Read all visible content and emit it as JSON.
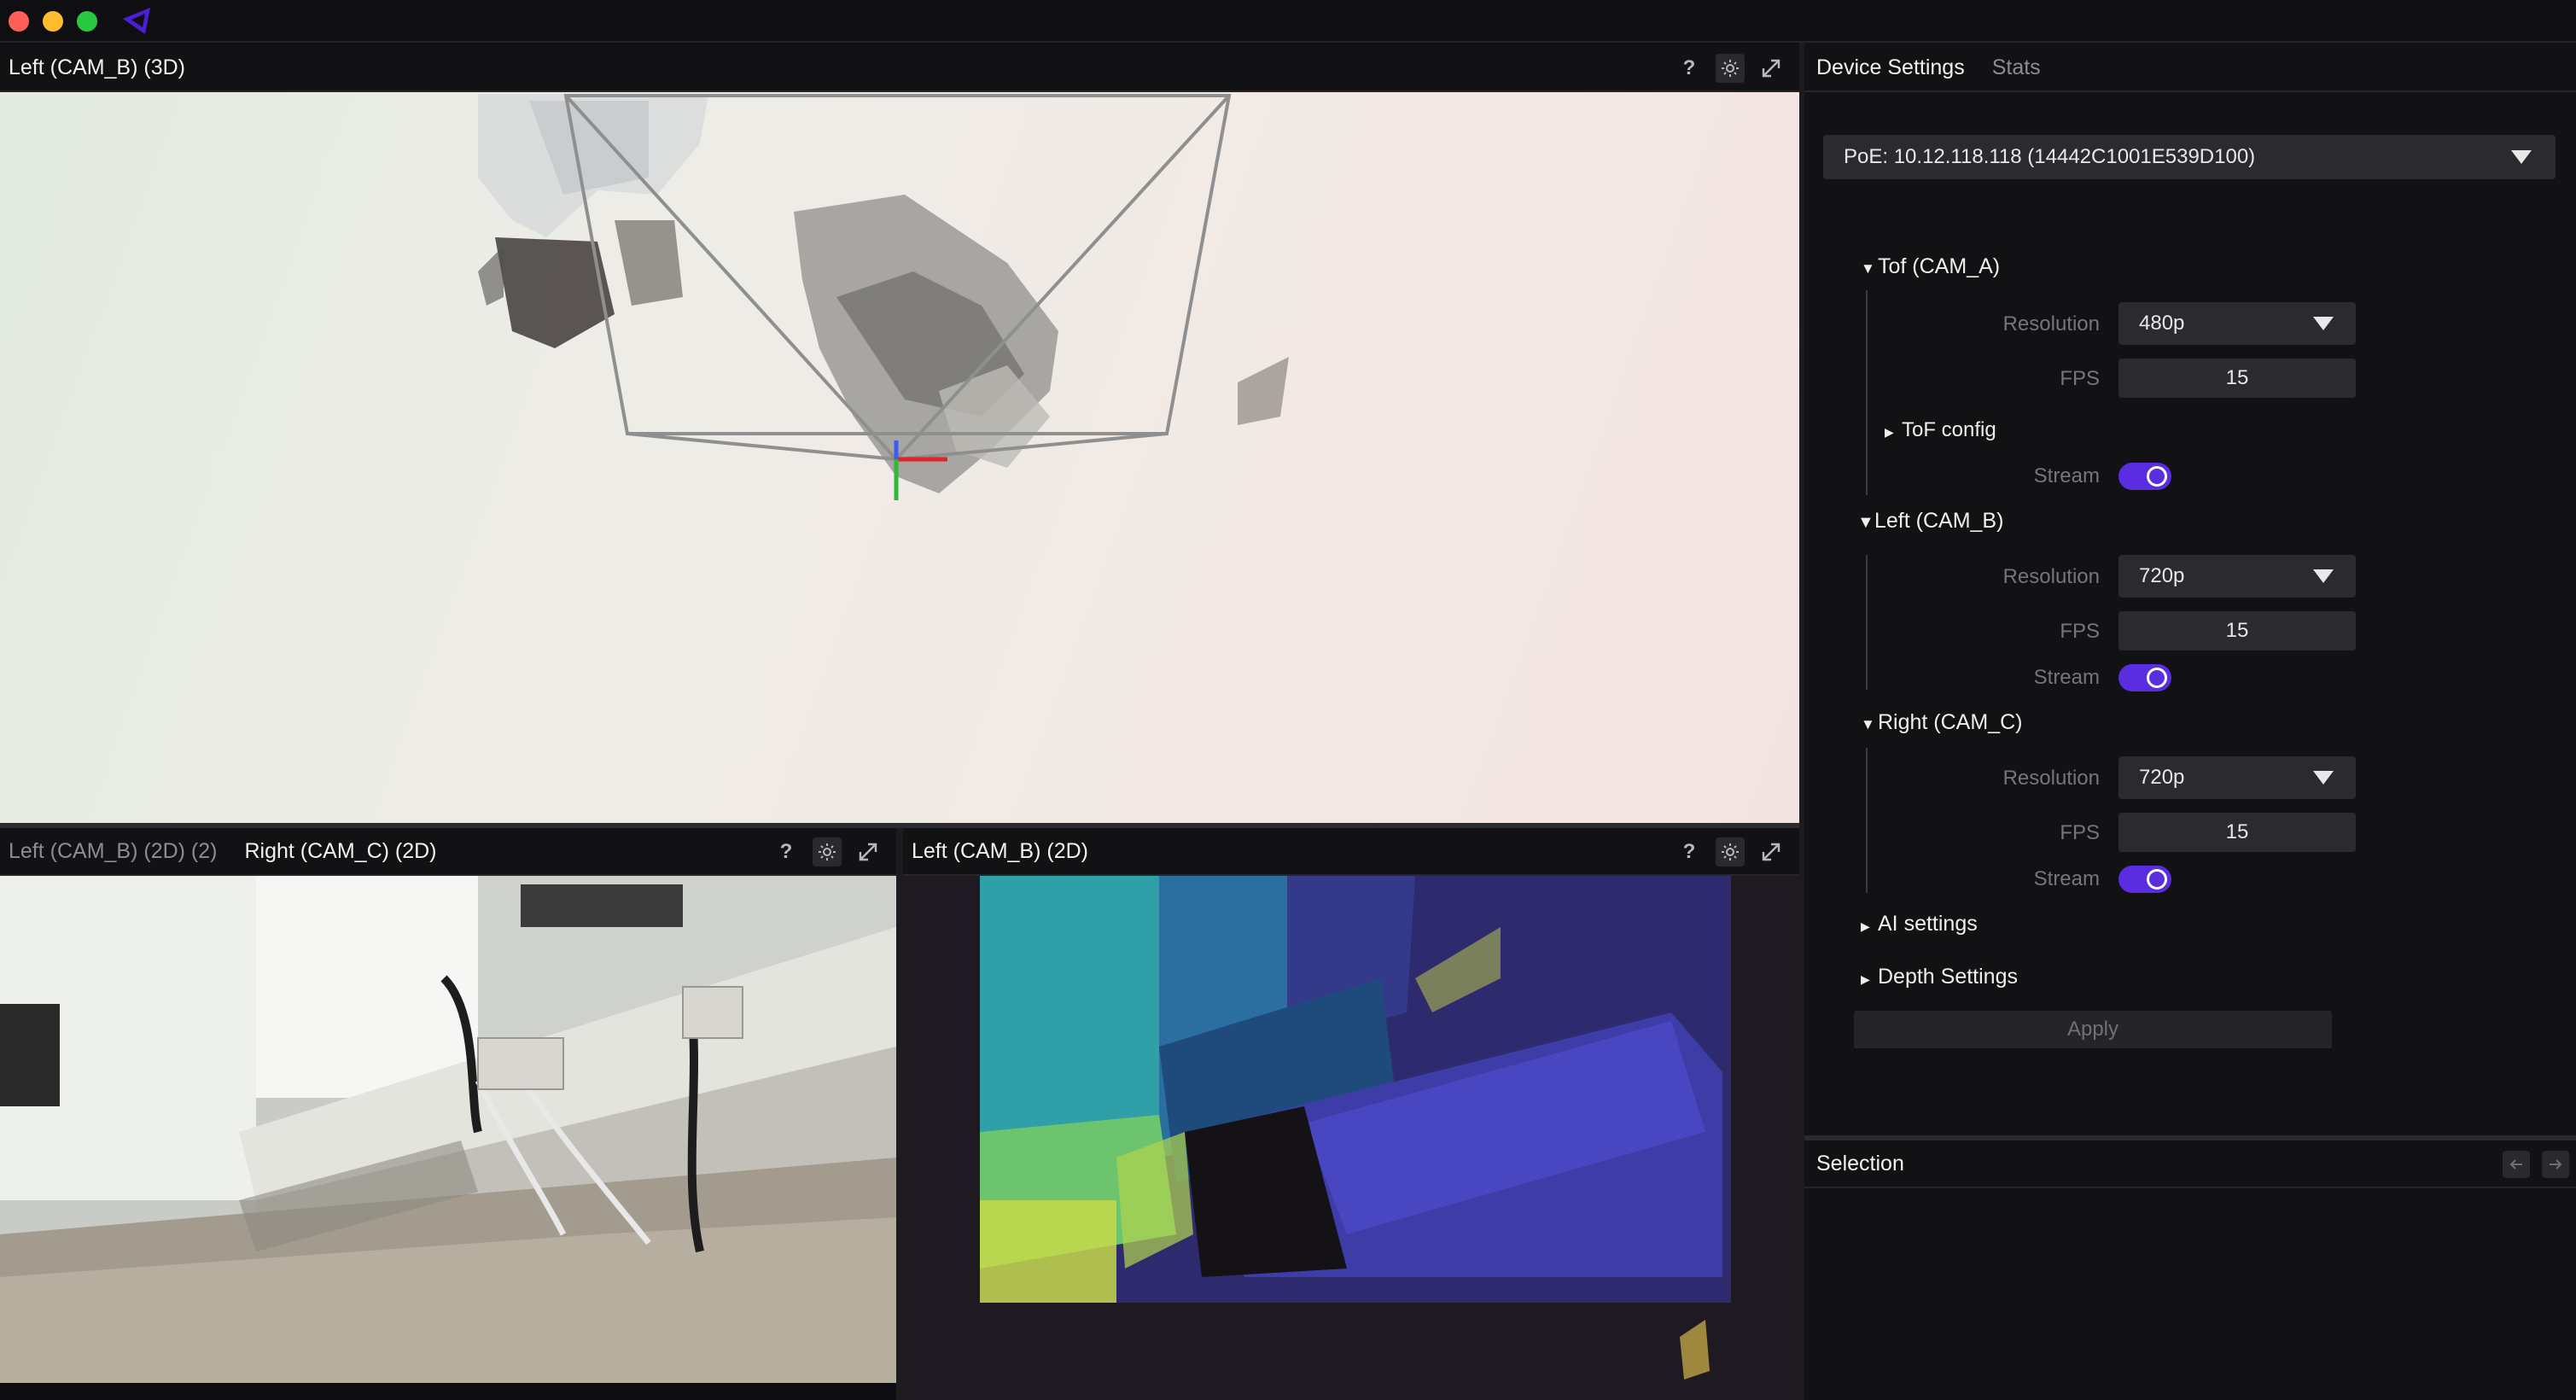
{
  "app": {
    "logo_icon": "rerun-triangle-logo",
    "colors": {
      "accent": "#5a2de0",
      "close": "#fe5f57",
      "minimize": "#febc2e",
      "maximize": "#28c840"
    }
  },
  "view_3d": {
    "title": "Left (CAM_B) (3D)",
    "help": "?",
    "icons": [
      "gear-icon",
      "expand-icon"
    ]
  },
  "view_bottom_left": {
    "tabs": [
      {
        "label": "Left (CAM_B) (2D) (2)",
        "active": false
      },
      {
        "label": "Right (CAM_C) (2D)",
        "active": true
      }
    ],
    "help": "?"
  },
  "view_bottom_right": {
    "title": "Left (CAM_B) (2D)",
    "help": "?"
  },
  "right_panel": {
    "tabs": [
      {
        "label": "Device Settings",
        "active": true
      },
      {
        "label": "Stats",
        "active": false
      }
    ],
    "device": "PoE: 10.12.118.118 (14442C1001E539D100)",
    "sections": {
      "tof": {
        "title": "Tof (CAM_A)",
        "resolution_label": "Resolution",
        "resolution": "480p",
        "fps_label": "FPS",
        "fps": "15",
        "tof_config": "ToF config",
        "stream_label": "Stream",
        "stream": true
      },
      "left": {
        "title": "Left (CAM_B)",
        "resolution_label": "Resolution",
        "resolution": "720p",
        "fps_label": "FPS",
        "fps": "15",
        "stream_label": "Stream",
        "stream": true
      },
      "right": {
        "title": "Right (CAM_C)",
        "resolution_label": "Resolution",
        "resolution": "720p",
        "fps_label": "FPS",
        "fps": "15",
        "stream_label": "Stream",
        "stream": true
      },
      "ai": {
        "title": "AI settings"
      },
      "depth": {
        "title": "Depth Settings"
      }
    },
    "apply_label": "Apply"
  },
  "selection": {
    "title": "Selection",
    "back_icon": "arrow-left-icon",
    "forward_icon": "arrow-right-icon"
  }
}
